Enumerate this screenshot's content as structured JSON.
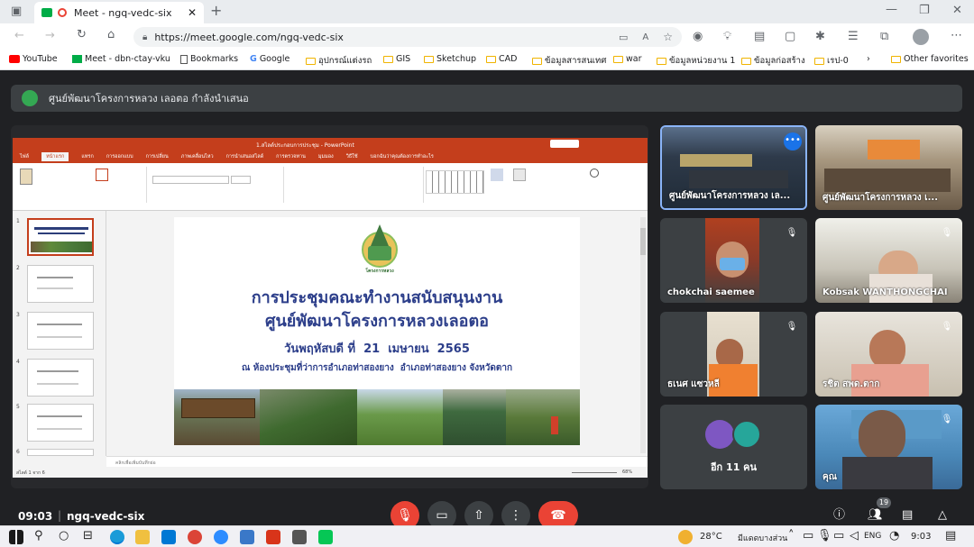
{
  "browser": {
    "tab_title": "Meet - ngq-vedc-six",
    "url": "https://meet.google.com/ngq-vedc-six",
    "bookmarks": [
      "YouTube",
      "Meet - dbn-ctay-vku",
      "Bookmarks",
      "Google",
      "อุปกรณ์แต่งรถ",
      "GIS",
      "Sketchup",
      "CAD",
      "ข้อมูลสารสนเทศ",
      "war",
      "ข้อมูลหน่วยงาน 1",
      "ข้อมูลก่อสร้าง",
      "เรป-0"
    ],
    "other_favorites": "Other favorites"
  },
  "meet": {
    "presenting_banner": "ศูนย์พัฒนาโครงการหลวง เลอตอ กำลังนำเสนอ",
    "meeting_code": "ngq-vedc-six",
    "time": "09:03",
    "participant_count": "19",
    "others_label": "อีก 11 คน",
    "participants": [
      {
        "name": "ศูนย์พัฒนาโครงการหลวง เล...",
        "mic": "on"
      },
      {
        "name": "ศูนย์พัฒนาโครงการหลวง เ...",
        "mic": "on"
      },
      {
        "name": "chokchai saemee",
        "mic": "off"
      },
      {
        "name": "Kobsak WANTHONGCHAI",
        "mic": "off"
      },
      {
        "name": "ธเนศ แซวหลี",
        "mic": "off"
      },
      {
        "name": "รชิต สพด.ตาก",
        "mic": "off"
      },
      {
        "name": "คุณ",
        "mic": "off"
      }
    ]
  },
  "ppt": {
    "title": "1.สไลด์ประกอบการประชุม - PowerPoint",
    "menu": [
      "ไฟล์",
      "หน้าแรก",
      "แทรก",
      "การออกแบบ",
      "การเปลี่ยน",
      "ภาพเคลื่อนไหว",
      "การนำเสนอสไลด์",
      "การตรวจทาน",
      "มุมมอง",
      "วิธีใช้",
      "บอกฉันว่าคุณต้องการทำอะไร"
    ],
    "slide_numbers": [
      "1",
      "2",
      "3",
      "4",
      "5",
      "6"
    ],
    "notes_hint": "คลิกเพื่อเพิ่มบันทึกย่อ",
    "status": "สไลด์ 1 จาก 6",
    "zoom": "68%",
    "slide": {
      "logo_text": "โครงการหลวง",
      "title_line1": "การประชุมคณะทำงานสนับสนุนงาน",
      "title_line2": "ศูนย์พัฒนาโครงการหลวงเลอตอ",
      "date": "วันพฤหัสบดี ที่  21  เมษายน  2565",
      "venue": "ณ ห้องประชุมที่ว่าการอำเภอท่าสองยาง  อำเภอท่าสองยาง จังหวัดตาก"
    }
  },
  "taskbar": {
    "temp": "28°C",
    "weather": "มีแดดบางส่วน",
    "lang": "ENG",
    "clock": "9:03"
  },
  "colors": {
    "accent": "#c43e1c",
    "end_call": "#ea4335",
    "meet_bg": "#202124"
  }
}
